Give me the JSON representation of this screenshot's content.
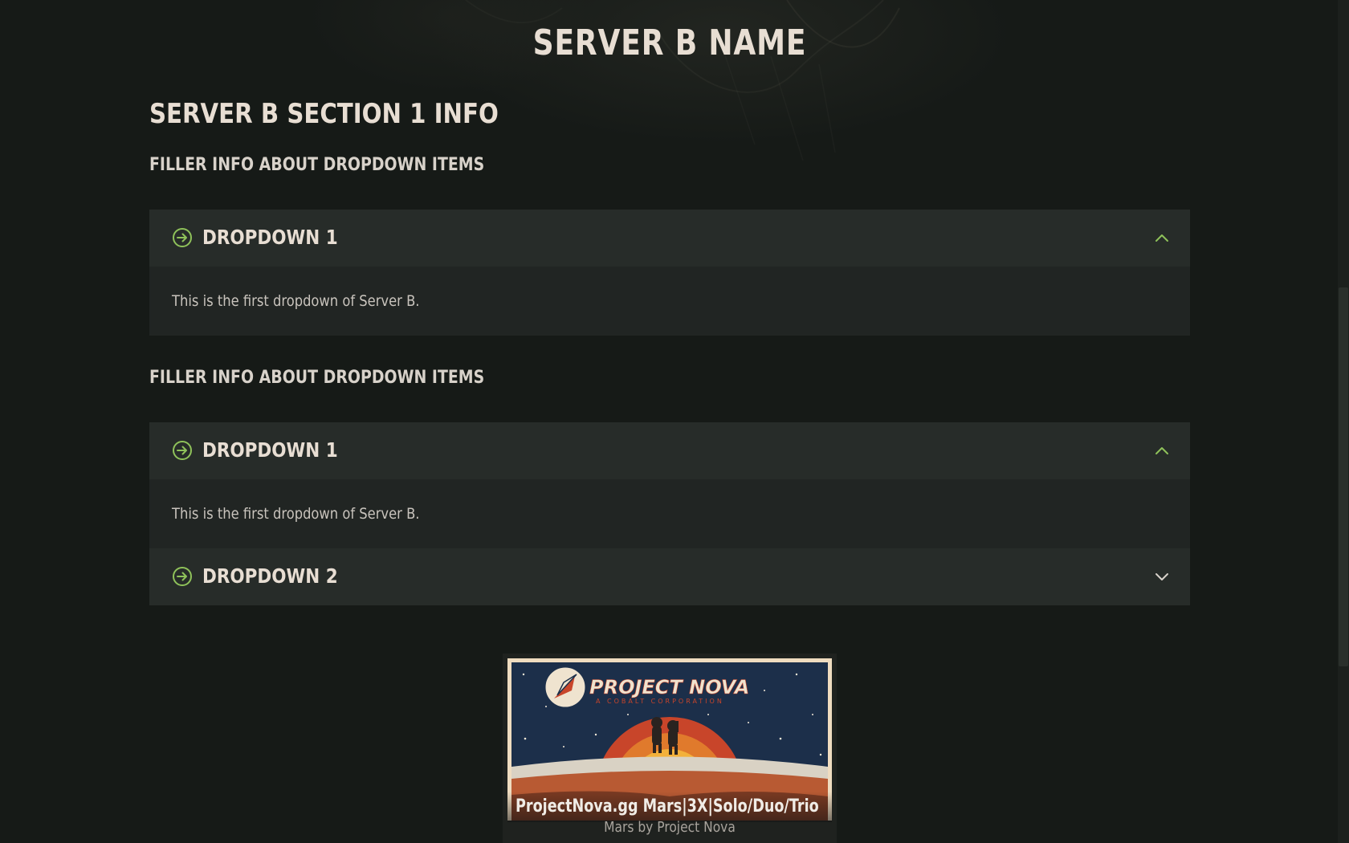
{
  "page": {
    "title": "SERVER B NAME"
  },
  "section": {
    "title": "SERVER B SECTION 1 INFO"
  },
  "groups": [
    {
      "filler": "FILLER INFO ABOUT DROPDOWN ITEMS",
      "dropdowns": [
        {
          "label": "DROPDOWN 1",
          "expanded": true,
          "body": "This is the first dropdown of Server B."
        }
      ]
    },
    {
      "filler": "FILLER INFO ABOUT DROPDOWN ITEMS",
      "dropdowns": [
        {
          "label": "DROPDOWN 1",
          "expanded": true,
          "body": "This is the first dropdown of Server B."
        },
        {
          "label": "DROPDOWN 2",
          "expanded": false
        }
      ]
    }
  ],
  "server_card": {
    "banner_brand": "PROJECT NOVA",
    "banner_tagline": "A COBALT CORPORATION",
    "name": "ProjectNova.gg Mars|3X|Solo/Duo/Trio",
    "subtitle": "Mars by Project Nova"
  },
  "colors": {
    "background": "#161a17",
    "panel": "#272c29",
    "panel_body": "#212523",
    "accent_green": "#8fc25a",
    "text_primary": "#e8ded3"
  },
  "icons": {
    "dropdown_icon": "arrow-circle-right-icon",
    "expanded_chevron": "chevron-up-icon",
    "collapsed_chevron": "chevron-down-icon"
  }
}
